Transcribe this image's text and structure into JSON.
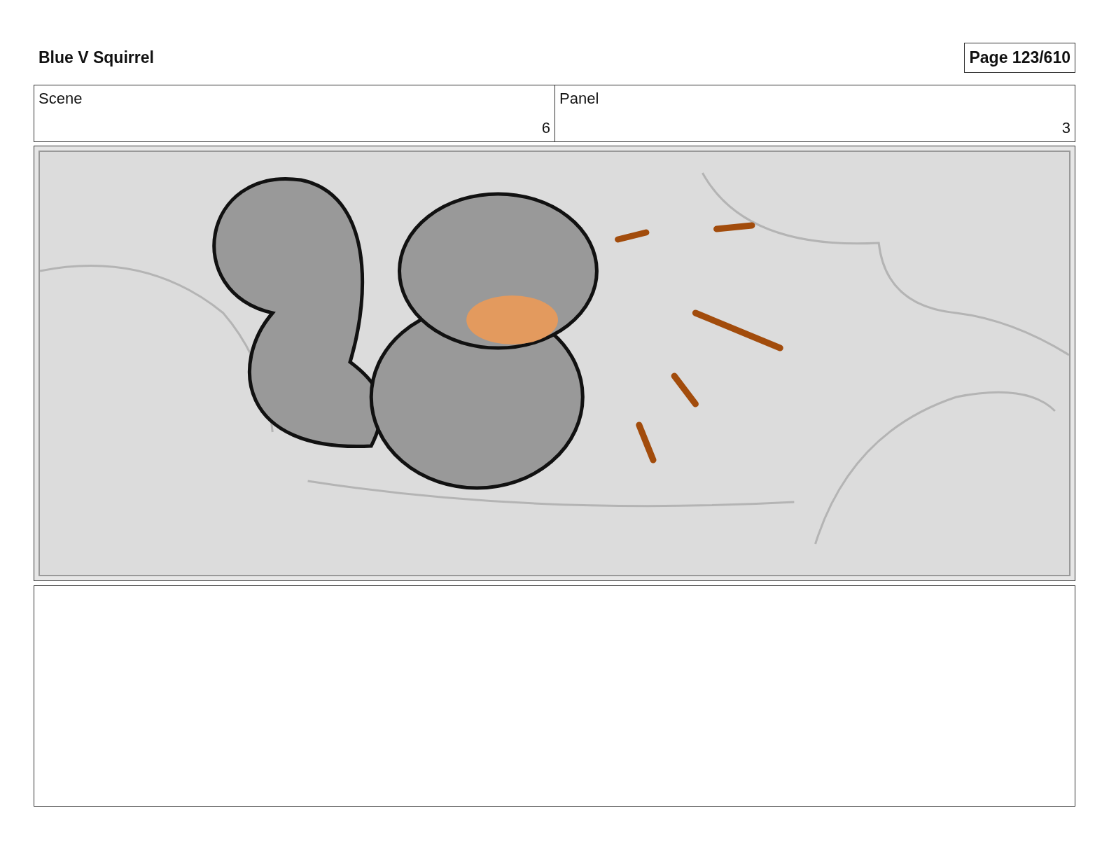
{
  "title": "Blue V Squirrel",
  "page": "Page 123/610",
  "info_table": {
    "columns": [
      "Scene",
      "Panel"
    ],
    "row": [
      "6",
      "3"
    ]
  }
}
